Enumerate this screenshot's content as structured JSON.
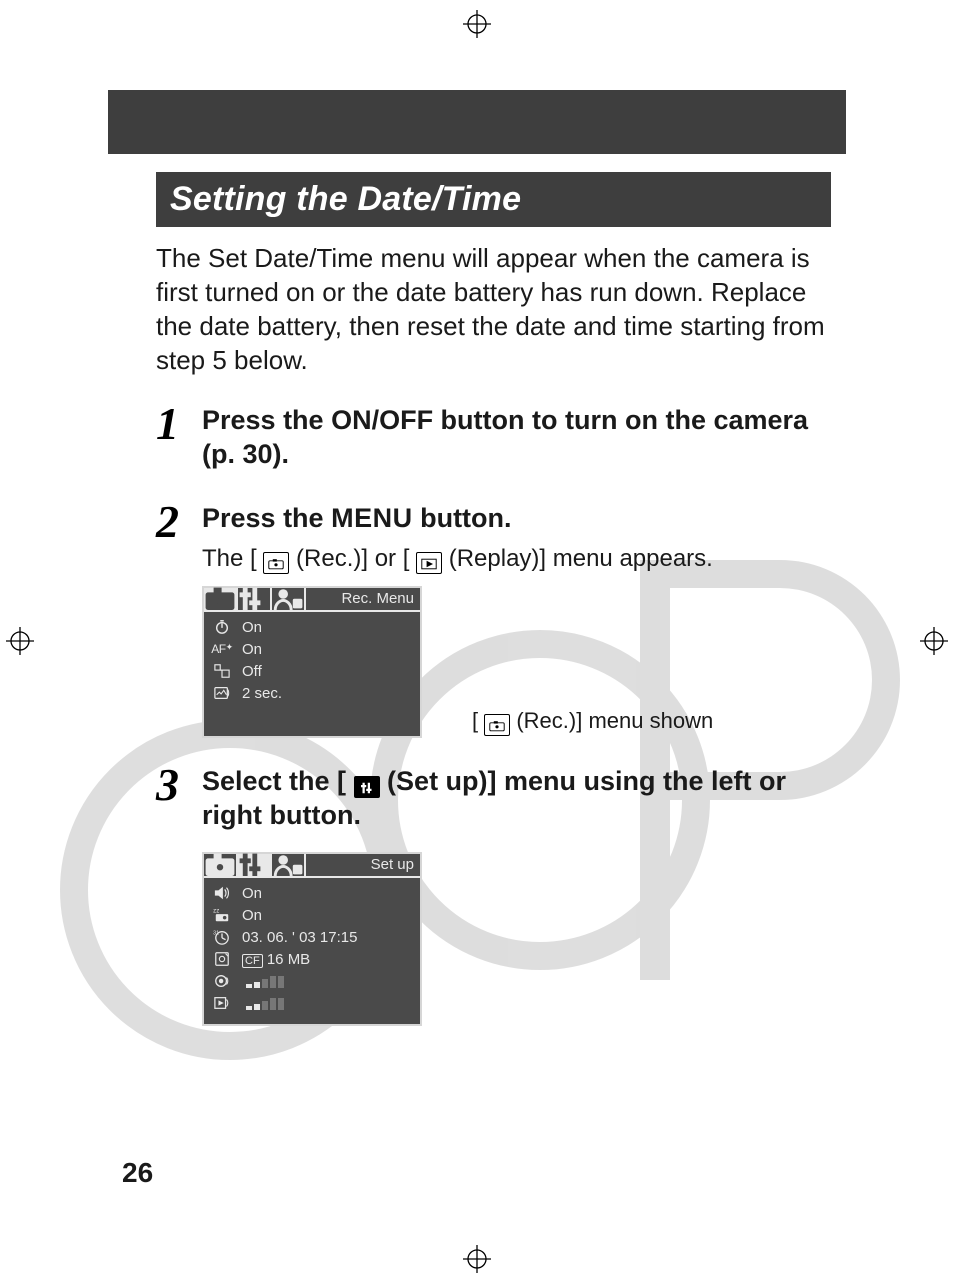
{
  "page_number": "26",
  "section_title": "Setting the Date/Time",
  "intro": "The Set Date/Time menu will appear when the camera is first turned on or the date battery has run down. Replace the date battery, then reset the date and time starting from step 5 below.",
  "steps": {
    "s1": {
      "num": "1",
      "head": "Press the ON/OFF button to turn on the camera (p. 30)."
    },
    "s2": {
      "num": "2",
      "head_before": "Press the ",
      "head_menu": "MENU",
      "head_after": " button.",
      "sub_before": "The [ ",
      "sub_mid": " (Rec.)] or [ ",
      "sub_after": " (Replay)] menu appears.",
      "caption_before": "[ ",
      "caption_after": " (Rec.)] menu shown"
    },
    "s3": {
      "num": "3",
      "head_before": "Select the [ ",
      "head_after": " (Set up)] menu using the left or right button."
    }
  },
  "lcd1": {
    "title": "Rec. Menu",
    "rows": [
      {
        "icon": "self-timer",
        "val": "On"
      },
      {
        "icon": "af-assist",
        "val": "On"
      },
      {
        "icon": "digital-zoom",
        "val": "Off"
      },
      {
        "icon": "review",
        "val": "2 sec."
      }
    ]
  },
  "lcd2": {
    "title": "Set up",
    "rows": [
      {
        "icon": "speaker",
        "val": "On"
      },
      {
        "icon": "power-save",
        "val": "On"
      },
      {
        "icon": "date",
        "val": "03. 06. ' 03 17:15"
      },
      {
        "icon": "format",
        "val_prefix": "CF",
        "val": " 16 MB"
      },
      {
        "icon": "shutter-vol",
        "bars": [
          2,
          3,
          5,
          7,
          7
        ],
        "active": 2
      },
      {
        "icon": "play-vol",
        "bars": [
          2,
          3,
          5,
          7,
          7
        ],
        "active": 2
      }
    ]
  }
}
